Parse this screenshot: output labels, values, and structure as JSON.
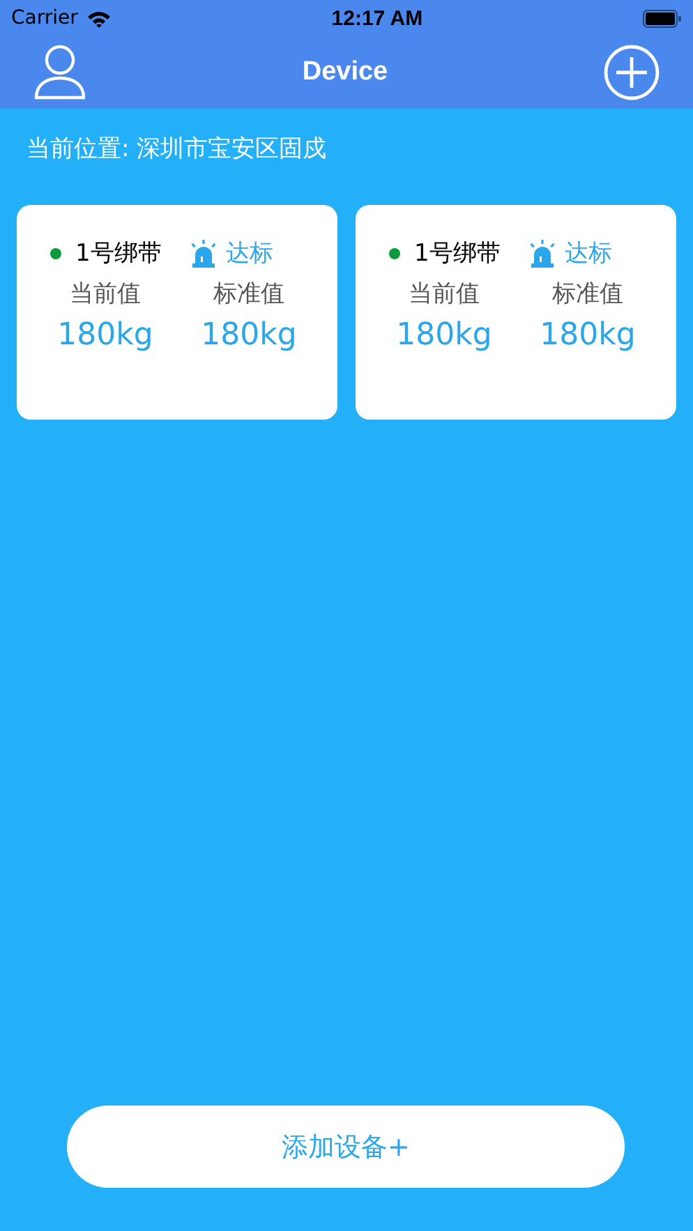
{
  "status_bar": {
    "carrier": "Carrier",
    "time": "12:17 AM"
  },
  "nav": {
    "title": "Device"
  },
  "location": "当前位置: 深圳市宝安区固戍",
  "devices": [
    {
      "name": "1号绑带",
      "color": "#0b9a3c",
      "status": "达标",
      "current_label": "当前值",
      "standard_label": "标准值",
      "current": "180kg",
      "standard": "180kg"
    },
    {
      "name": "1号绑带",
      "color": "#0b9a3c",
      "status": "达标",
      "current_label": "当前值",
      "standard_label": "标准值",
      "current": "180kg",
      "standard": "180kg"
    }
  ],
  "add_button": "添加设备+"
}
